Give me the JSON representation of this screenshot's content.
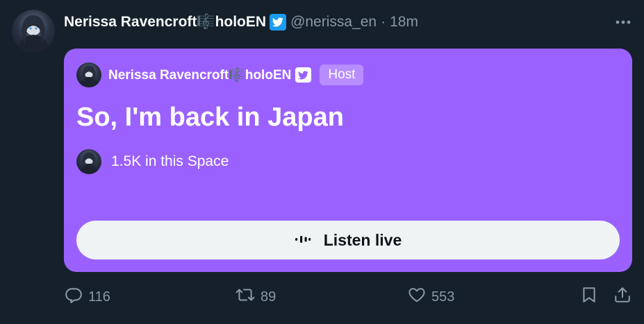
{
  "tweet": {
    "author": {
      "display_name": "Nerissa Ravencroft🎼holoEN",
      "handle": "@nerissa_en",
      "separator": "·",
      "time": "18m"
    },
    "space_card": {
      "host_name": "Nerissa Ravencroft🎼holoEN",
      "host_badge": "Host",
      "title": "So, I'm back in Japan",
      "listeners": "1.5K in this Space",
      "listen_button": "Listen live",
      "background_color": "#9b61ff"
    },
    "actions": {
      "replies": "116",
      "retweets": "89",
      "likes": "553"
    }
  },
  "icons": {
    "verified": "verified-badge-icon",
    "more": "more-dots-icon",
    "reply": "reply-icon",
    "retweet": "retweet-icon",
    "like": "heart-icon",
    "bookmark": "bookmark-icon",
    "share": "share-icon",
    "audio": "audio-wave-icon"
  }
}
